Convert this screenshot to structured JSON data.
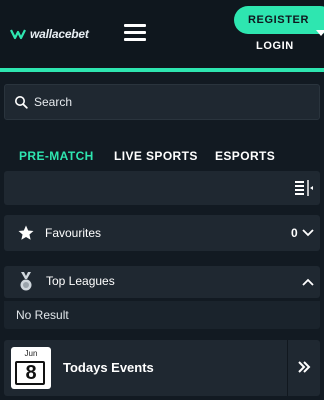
{
  "header": {
    "logo_text": "wallacebet",
    "register_label": "REGISTER",
    "login_label": "LOGIN"
  },
  "search": {
    "placeholder": "Search"
  },
  "tabs": [
    {
      "label": "PRE-MATCH",
      "active": true
    },
    {
      "label": "LIVE SPORTS",
      "active": false
    },
    {
      "label": "ESPORTS",
      "active": false
    }
  ],
  "favourites": {
    "label": "Favourites",
    "count": "0"
  },
  "top_leagues": {
    "label": "Top Leagues",
    "empty_text": "No Result"
  },
  "todays_events": {
    "label": "Todays Events",
    "calendar_month": "Jun",
    "calendar_day": "8"
  },
  "colors": {
    "accent": "#2ee6b0",
    "background": "#121a22",
    "panel": "#1f2831"
  }
}
